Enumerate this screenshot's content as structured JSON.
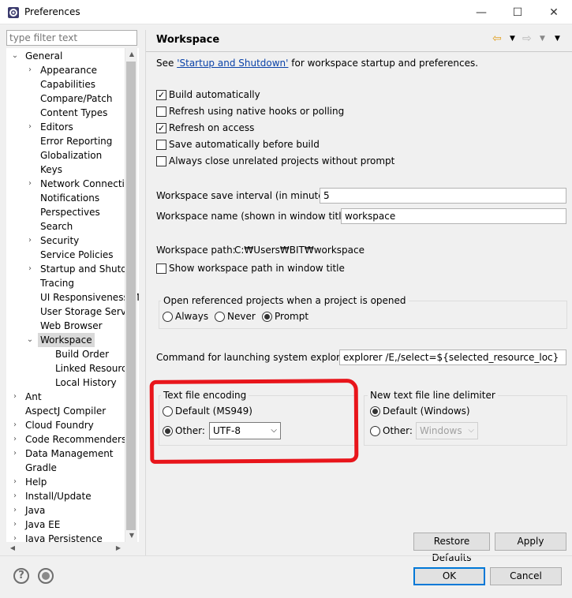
{
  "window": {
    "title": "Preferences",
    "min": "—",
    "max": "☐",
    "close": "✕"
  },
  "filter": {
    "placeholder": "type filter text"
  },
  "tree": {
    "general": "General",
    "general_children": [
      "Appearance",
      "Capabilities",
      "Compare/Patch",
      "Content Types",
      "Editors",
      "Error Reporting",
      "Globalization",
      "Keys",
      "Network Connectio",
      "Notifications",
      "Perspectives",
      "Search",
      "Security",
      "Service Policies",
      "Startup and Shutdo",
      "Tracing",
      "UI Responsiveness M",
      "User Storage Servic",
      "Web Browser",
      "Workspace"
    ],
    "workspace_children": [
      "Build Order",
      "Linked Resource",
      "Local History"
    ],
    "roots": [
      "Ant",
      "AspectJ Compiler",
      "Cloud Foundry",
      "Code Recommenders",
      "Data Management",
      "Gradle",
      "Help",
      "Install/Update",
      "Java",
      "Java EE",
      "Java Persistence"
    ]
  },
  "page": {
    "title": "Workspace",
    "see_prefix": "See ",
    "see_link": "'Startup and Shutdown'",
    "see_suffix": " for workspace startup and preferences.",
    "checks": [
      {
        "label": "Build automatically",
        "checked": true
      },
      {
        "label": "Refresh using native hooks or polling",
        "checked": false
      },
      {
        "label": "Refresh on access",
        "checked": true
      },
      {
        "label": "Save automatically before build",
        "checked": false
      },
      {
        "label": "Always close unrelated projects without prompt",
        "checked": false
      }
    ],
    "save_interval_label": "Workspace save interval (in minutes):",
    "save_interval_value": "5",
    "name_label": "Workspace name (shown in window title):",
    "name_value": "workspace",
    "path_label": "Workspace path:",
    "path_value": "C:₩Users₩BIT₩workspace",
    "show_path_label": "Show workspace path in window title",
    "open_ref_title": "Open referenced projects when a project is opened",
    "open_ref_options": [
      "Always",
      "Never",
      "Prompt"
    ],
    "explorer_label": "Command for launching system explorer:",
    "explorer_value": "explorer /E,/select=${selected_resource_loc}",
    "encoding_title": "Text file encoding",
    "encoding_default": "Default (MS949)",
    "encoding_other": "Other:",
    "encoding_value": "UTF-8",
    "delim_title": "New text file line delimiter",
    "delim_default": "Default (Windows)",
    "delim_other": "Other:",
    "delim_value": "Windows",
    "restore": "Restore Defaults",
    "apply": "Apply"
  },
  "footer": {
    "ok": "OK",
    "cancel": "Cancel",
    "help_glyph": "?"
  }
}
